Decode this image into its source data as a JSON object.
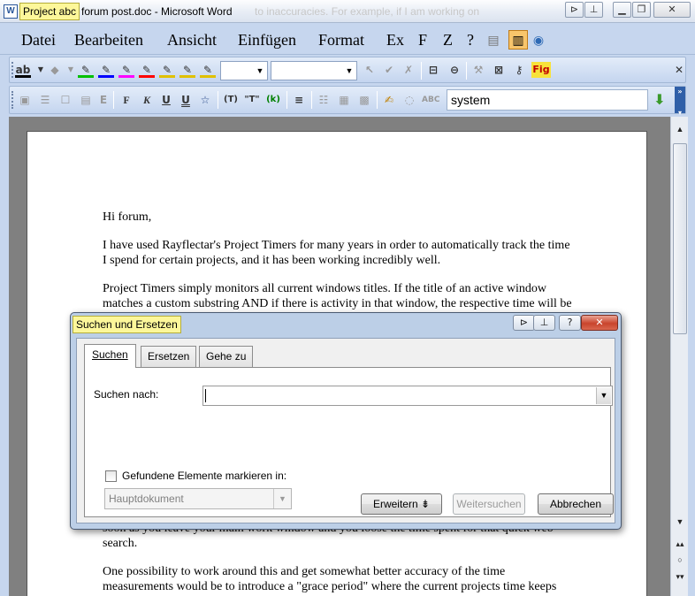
{
  "window": {
    "project_badge": "Project abc",
    "title": "forum post.doc - Microsoft Word",
    "ghost_text": "to inaccuracies. For example, if I am working on",
    "app_icon": "word-doc-icon"
  },
  "menu": {
    "items": [
      "Datei",
      "Bearbeiten",
      "Ansicht",
      "Einfügen",
      "Format",
      "Ex",
      "F",
      "Z",
      "?"
    ]
  },
  "toolbar2": {
    "search_value": "system"
  },
  "toolbar1": {
    "fig_label": "Fig"
  },
  "document": {
    "paragraphs": [
      "Hi forum,",
      "I have used Rayflectar's Project Timers for many years in order to automatically track the time I spend for certain projects, and it has been working incredibly well.",
      "Project Timers simply monitors all current windows titles. If the title of an active window matches a custom substring AND if there is activity in that window, the respective time will be added to the project associated with that substring."
    ],
    "bottom_paragraphs": [
      "soon as you leave your main work window and you loose the time spent for that quick web search.",
      "One possibility to work around this and get somewhat better accuracy of the time measurements would be to introduce a \"grace period\" where the current projects time keeps"
    ]
  },
  "dialog": {
    "title": "Suchen und Ersetzen",
    "tabs": [
      "Suchen",
      "Ersetzen",
      "Gehe zu"
    ],
    "search_label": "Suchen nach:",
    "search_value": "",
    "checkbox_label": "Gefundene Elemente markieren in:",
    "checkbox_checked": false,
    "location_value": "Hauptdokument",
    "buttons": {
      "erweitern": "Erweitern",
      "weitersuchen": "Weitersuchen",
      "abbrechen": "Abbrechen"
    }
  },
  "colors": {
    "badge": "#fdf79a",
    "chrome": "#c6d6ee",
    "close_button": "#c9442c"
  }
}
